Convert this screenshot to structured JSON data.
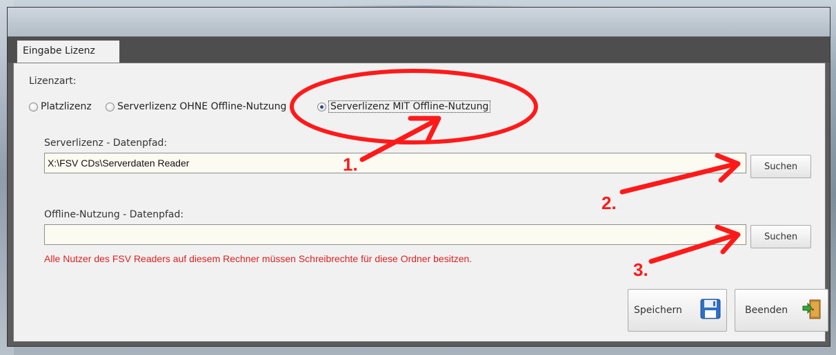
{
  "tab": {
    "label": "Eingabe Lizenz"
  },
  "license_type": {
    "label": "Lizenzart:",
    "options": [
      {
        "label": "Platzlizenz",
        "checked": false
      },
      {
        "label": "Serverlizenz OHNE Offline-Nutzung",
        "checked": false
      },
      {
        "label": "Serverlizenz MIT Offline-Nutzung",
        "checked": true
      }
    ]
  },
  "server_path": {
    "label": "Serverlizenz - Datenpfad:",
    "value": "X:\\FSV CDs\\Serverdaten Reader",
    "button": "Suchen"
  },
  "offline_path": {
    "label": "Offline-Nutzung - Datenpfad:",
    "value": "",
    "button": "Suchen"
  },
  "warning": "Alle Nutzer des FSV Readers auf diesem Rechner müssen Schreibrechte für diese Ordner besitzen.",
  "actions": {
    "save": "Speichern",
    "close": "Beenden",
    "save_icon": "floppy-disk-icon",
    "close_icon": "exit-door-icon"
  },
  "annotations": {
    "step1": "1.",
    "step2": "2.",
    "step3": "3.",
    "color": "#ff1a1a"
  }
}
